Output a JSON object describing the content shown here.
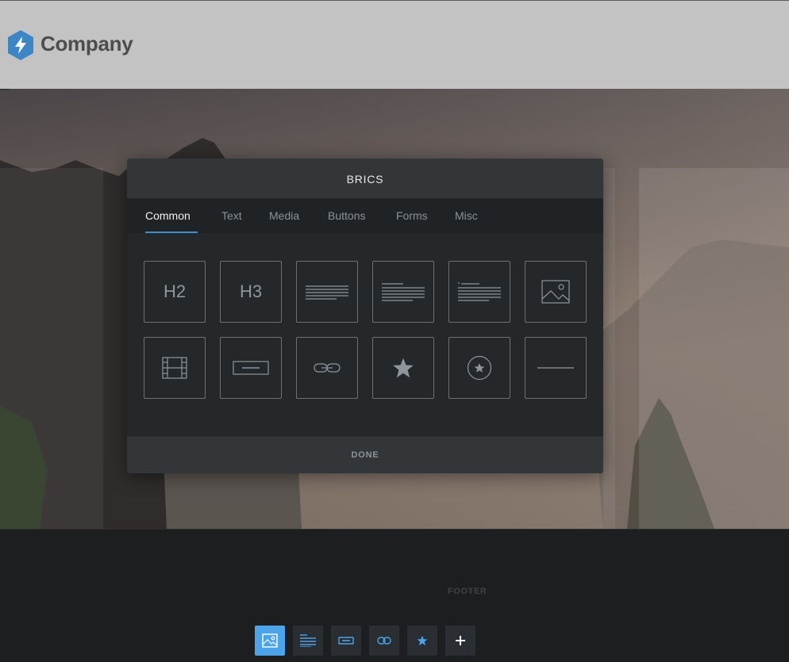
{
  "header": {
    "company_name": "Company",
    "logo_icon": "bolt-hexagon-icon",
    "logo_color": "#3d86c6"
  },
  "modal": {
    "title": "BRICS",
    "tabs": [
      {
        "label": "Common",
        "active": true
      },
      {
        "label": "Text",
        "active": false
      },
      {
        "label": "Media",
        "active": false
      },
      {
        "label": "Buttons",
        "active": false
      },
      {
        "label": "Forms",
        "active": false
      },
      {
        "label": "Misc",
        "active": false
      }
    ],
    "bricks": [
      {
        "icon": "h2-icon",
        "label": "H2"
      },
      {
        "icon": "h3-icon",
        "label": "H3"
      },
      {
        "icon": "paragraph-icon"
      },
      {
        "icon": "heading-paragraph-icon"
      },
      {
        "icon": "heading-paragraph-alt-icon"
      },
      {
        "icon": "image-icon"
      },
      {
        "icon": "video-icon"
      },
      {
        "icon": "button-icon"
      },
      {
        "icon": "link-icon"
      },
      {
        "icon": "star-icon"
      },
      {
        "icon": "star-circle-icon"
      },
      {
        "icon": "divider-icon"
      }
    ],
    "done_label": "DONE",
    "accent_color": "#3d8fd1"
  },
  "footer": {
    "label": "FOOTER"
  },
  "toolbar": {
    "buttons": [
      {
        "icon": "image-icon",
        "active": true
      },
      {
        "icon": "text-icon",
        "active": false
      },
      {
        "icon": "button-icon",
        "active": false
      },
      {
        "icon": "link-icon",
        "active": false
      },
      {
        "icon": "star-icon",
        "active": false
      },
      {
        "icon": "plus-icon",
        "active": false
      }
    ],
    "active_color": "#4da3ea",
    "icon_color": "#4da3ea"
  }
}
